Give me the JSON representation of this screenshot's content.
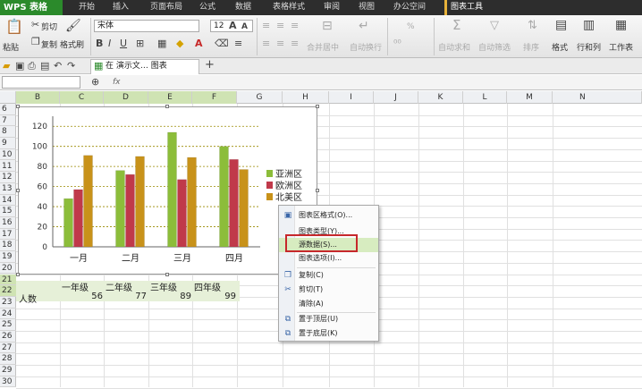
{
  "menubar": {
    "app_name": "WPS 表格",
    "tabs": [
      "开始",
      "插入",
      "页面布局",
      "公式",
      "数据",
      "表格样式",
      "审阅",
      "视图",
      "办公空间"
    ],
    "active_tool_tab": "图表工具"
  },
  "ribbon": {
    "paste": "粘贴",
    "cut": "剪切",
    "copy": "复制",
    "format_painter": "格式刷",
    "font_name": "宋体",
    "font_size": "12",
    "merge_center": "合并居中",
    "auto_wrap": "自动换行",
    "auto_sum": "自动求和",
    "auto_filter": "自动筛选",
    "sort": "排序",
    "format": "格式",
    "rows_cols": "行和列",
    "worksheet": "工作表",
    "percent": "%"
  },
  "tabbar": {
    "doc_tab": "在  演示文…  图表",
    "add_tab": "+"
  },
  "formulabar": {
    "fx": "fx"
  },
  "columns": [
    "B",
    "C",
    "D",
    "E",
    "F",
    "G",
    "H",
    "I",
    "J",
    "K",
    "L",
    "M",
    "N"
  ],
  "selected_columns": [
    "B",
    "C",
    "D",
    "E",
    "F"
  ],
  "rows": [
    "6",
    "7",
    "8",
    "9",
    "10",
    "11",
    "12",
    "13",
    "14",
    "15",
    "16",
    "17",
    "18",
    "19",
    "20",
    "21",
    "22",
    "23",
    "24",
    "25",
    "26",
    "27",
    "28",
    "29",
    "30"
  ],
  "selected_rows": [
    "21",
    "22"
  ],
  "table": {
    "headers": [
      "一年级",
      "二年级",
      "三年级",
      "四年级"
    ],
    "row_label": "人数",
    "values": [
      "56",
      "77",
      "89",
      "99"
    ]
  },
  "chart_data": {
    "type": "bar",
    "categories": [
      "一月",
      "二月",
      "三月",
      "四月"
    ],
    "series": [
      {
        "name": "亚洲区",
        "values": [
          48,
          76,
          114,
          100
        ],
        "color": "#8cbd3a"
      },
      {
        "name": "欧洲区",
        "values": [
          57,
          72,
          67,
          87
        ],
        "color": "#c0394a"
      },
      {
        "name": "北美区",
        "values": [
          91,
          90,
          89,
          77
        ],
        "color": "#c8921a"
      }
    ],
    "yticks": [
      "0",
      "20",
      "40",
      "60",
      "80",
      "100",
      "120"
    ],
    "ylim": [
      0,
      130
    ],
    "grid": "dashed",
    "legend": "right"
  },
  "context_menu": {
    "items": [
      {
        "label": "图表区格式(O)...",
        "icon": "chart-format-icon"
      },
      {
        "label": "图表类型(Y)...",
        "icon": ""
      },
      {
        "label": "源数据(S)...",
        "icon": "",
        "highlighted": true
      },
      {
        "label": "图表选项(I)...",
        "icon": ""
      },
      {
        "label": "复制(C)",
        "icon": "copy-icon"
      },
      {
        "label": "剪切(T)",
        "icon": "scissors-icon"
      },
      {
        "label": "清除(A)",
        "icon": ""
      },
      {
        "label": "置于顶层(U)",
        "icon": "bring-front-icon"
      },
      {
        "label": "置于底层(K)",
        "icon": "send-back-icon"
      }
    ]
  }
}
